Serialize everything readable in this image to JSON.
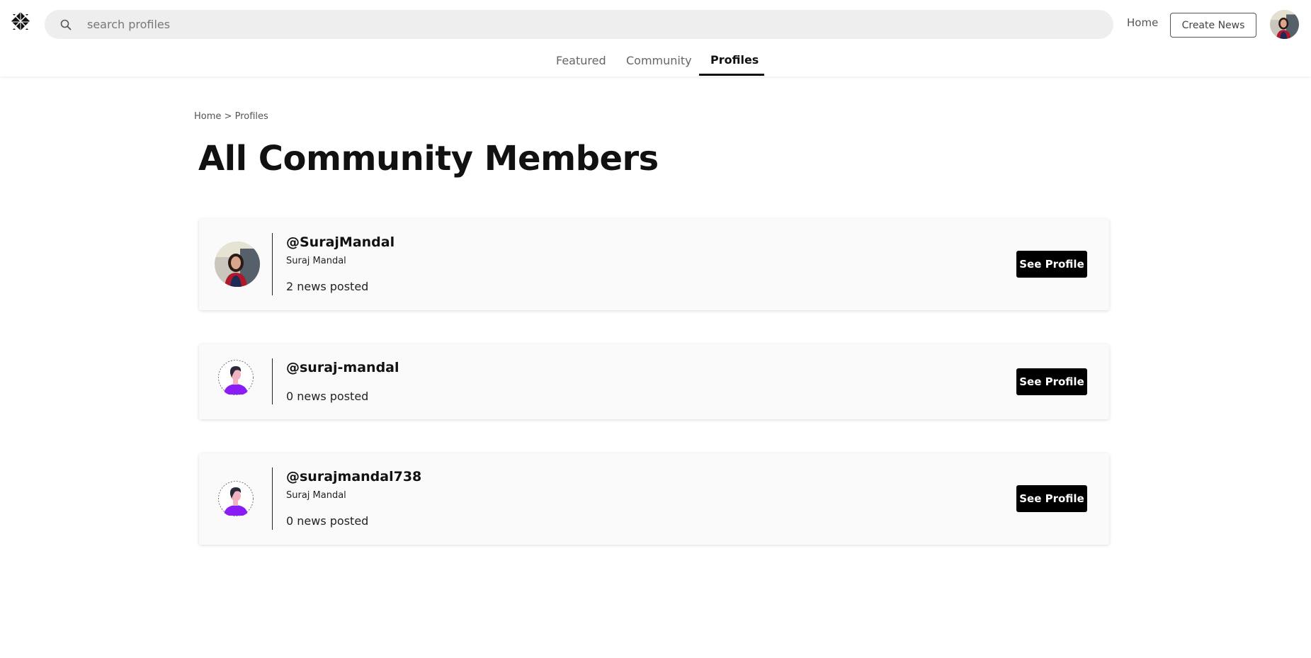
{
  "header": {
    "search_placeholder": "search profiles",
    "home_link": "Home",
    "create_button": "Create News"
  },
  "tabs": [
    {
      "label": "Featured",
      "active": false
    },
    {
      "label": "Community",
      "active": false
    },
    {
      "label": "Profiles",
      "active": true
    }
  ],
  "breadcrumb": {
    "home": "Home",
    "separator": ">",
    "current": "Profiles"
  },
  "page": {
    "title": "All Community Members"
  },
  "members": [
    {
      "username": "@SurajMandal",
      "name": "Suraj Mandal",
      "news": "2 news posted",
      "avatar": "photo-avatar",
      "button": "See Profile"
    },
    {
      "username": "@suraj-mandal",
      "name": "",
      "news": "0 news posted",
      "avatar": "default-avatar",
      "button": "See Profile"
    },
    {
      "username": "@surajmandal738",
      "name": "Suraj Mandal",
      "news": "0 news posted",
      "avatar": "default-avatar",
      "button": "See Profile"
    }
  ],
  "colors": {
    "accent": "#000000",
    "search_bg": "#eeeeee",
    "card_bg": "#fafafa",
    "default_avatar_shirt": "#8a1cf5"
  }
}
